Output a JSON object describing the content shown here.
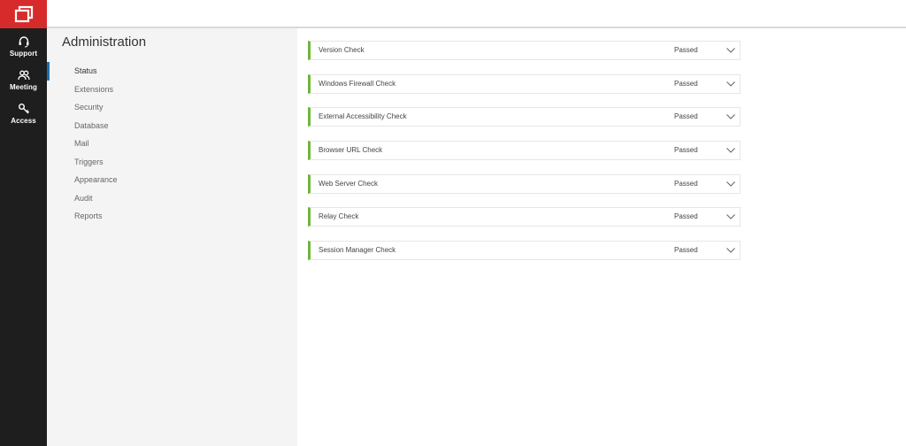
{
  "brand": {
    "accent": "#d72b2b",
    "logo_icon": "window-logo-icon"
  },
  "rail": {
    "items": [
      {
        "label": "Support",
        "icon": "headset-icon"
      },
      {
        "label": "Meeting",
        "icon": "people-icon"
      },
      {
        "label": "Access",
        "icon": "key-icon"
      }
    ]
  },
  "admin": {
    "title": "Administration",
    "nav": [
      {
        "label": "Status",
        "active": true
      },
      {
        "label": "Extensions"
      },
      {
        "label": "Security"
      },
      {
        "label": "Database"
      },
      {
        "label": "Mail"
      },
      {
        "label": "Triggers"
      },
      {
        "label": "Appearance"
      },
      {
        "label": "Audit"
      },
      {
        "label": "Reports"
      }
    ]
  },
  "checks": [
    {
      "name": "Version Check",
      "status": "Passed"
    },
    {
      "name": "Windows Firewall Check",
      "status": "Passed"
    },
    {
      "name": "External Accessibility Check",
      "status": "Passed"
    },
    {
      "name": "Browser URL Check",
      "status": "Passed"
    },
    {
      "name": "Web Server Check",
      "status": "Passed"
    },
    {
      "name": "Relay Check",
      "status": "Passed"
    },
    {
      "name": "Session Manager Check",
      "status": "Passed"
    }
  ],
  "colors": {
    "pass_bar": "#6fb537",
    "active_indicator": "#1f6fb2",
    "rail_bg": "#1e1e1e"
  }
}
